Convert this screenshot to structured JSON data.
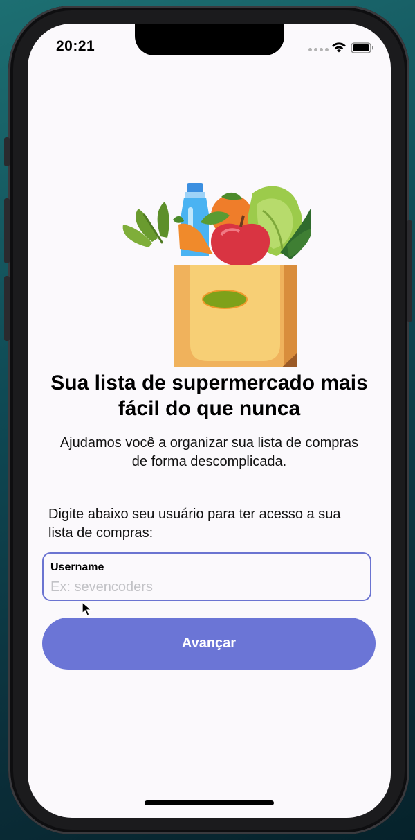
{
  "status_bar": {
    "time": "20:21"
  },
  "intro": {
    "headline_lines": [
      "Sua lista de supermercado mais",
      "fácil do que nunca"
    ],
    "subtitle_lines": [
      "Ajudamos você a organizar sua lista de compras",
      "de forma descomplicada."
    ]
  },
  "login": {
    "instruction_lines": [
      "Digite abaixo seu usuário para ter acesso a sua",
      "lista de compras:"
    ],
    "username_label": "Username",
    "username_placeholder": "Ex: sevencoders",
    "username_value": "",
    "submit_label": "Avançar"
  },
  "colors": {
    "accent": "#6b75d6",
    "input_border": "#6b74d1",
    "background": "#fbf9fc"
  },
  "icons": {
    "hero": "grocery-bag-illustration",
    "wifi": "wifi-icon",
    "battery": "battery-icon",
    "signal": "cellular-signal-icon",
    "cursor": "mouse-pointer-icon"
  }
}
